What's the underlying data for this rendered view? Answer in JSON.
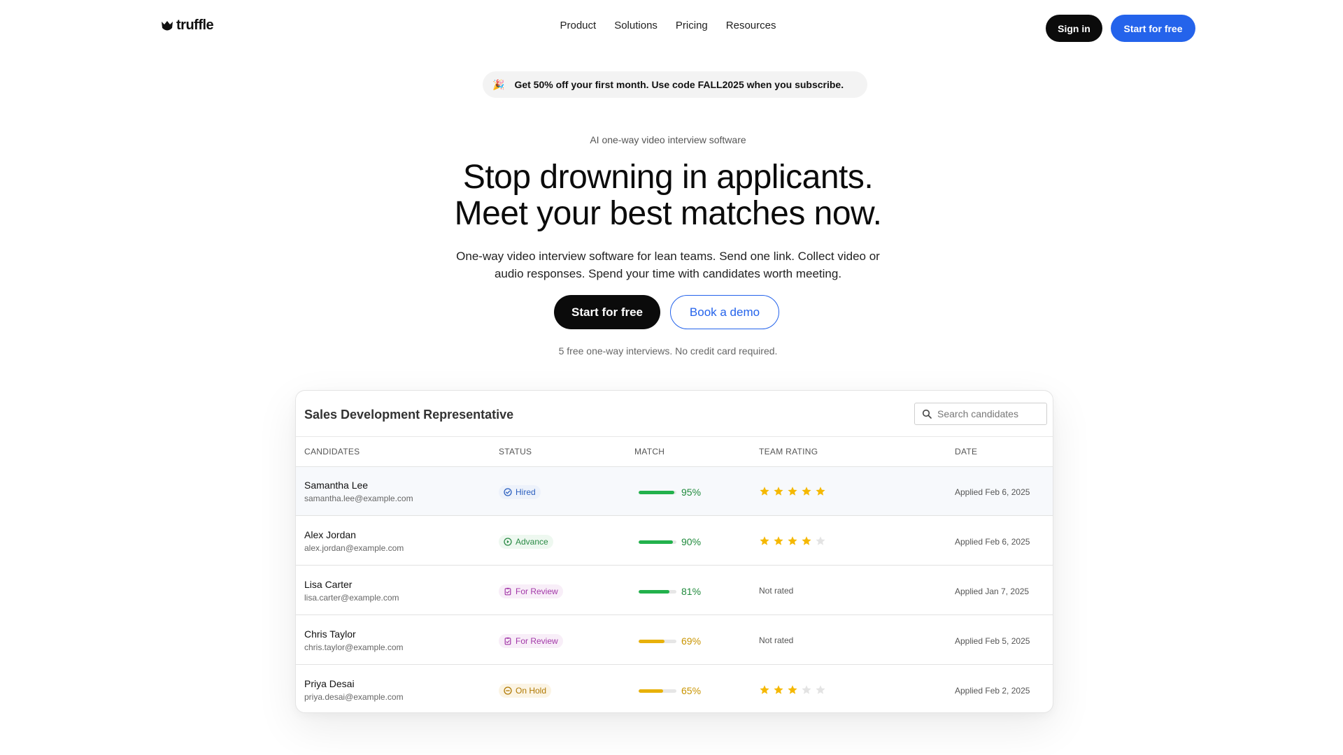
{
  "brand": {
    "name": "truffle",
    "icon": "truffle-logo-icon"
  },
  "nav": {
    "links": [
      "Product",
      "Solutions",
      "Pricing",
      "Resources"
    ],
    "signin_label": "Sign in",
    "start_label": "Start for free"
  },
  "promo": {
    "icon": "party-popper-icon",
    "text": "Get 50% off your first month. Use code FALL2025 when you subscribe."
  },
  "hero": {
    "eyebrow": "AI one-way video interview software",
    "headline_line1": "Stop drowning in applicants.",
    "headline_line2": "Meet your best matches now.",
    "sub_line1": "One-way video interview software for lean teams. Send one link. Collect video or",
    "sub_line2": "audio responses. Spend your time with candidates worth meeting.",
    "start_label": "Start for free",
    "demo_label": "Book a demo",
    "note": "5 free one-way interviews.  No credit card required."
  },
  "table": {
    "title": "Sales Development Representative",
    "search_placeholder": "Search candidates",
    "columns": [
      "CANDIDATES",
      "STATUS",
      "MATCH",
      "TEAM RATING",
      "DATE"
    ],
    "rows": [
      {
        "name": "Samantha Lee",
        "email": "samantha.lee@example.com",
        "status": "Hired",
        "status_kind": "hired",
        "match": 95,
        "match_label": "95%",
        "color": "green",
        "rating": 5,
        "rating_text": "",
        "date": "Applied Feb 6, 2025"
      },
      {
        "name": "Alex Jordan",
        "email": "alex.jordan@example.com",
        "status": "Advance",
        "status_kind": "advance",
        "match": 90,
        "match_label": "90%",
        "color": "green",
        "rating": 4,
        "rating_text": "",
        "date": "Applied Feb 6, 2025"
      },
      {
        "name": "Lisa Carter",
        "email": "lisa.carter@example.com",
        "status": "For Review",
        "status_kind": "review",
        "match": 81,
        "match_label": "81%",
        "color": "green",
        "rating": 0,
        "rating_text": "Not rated",
        "date": "Applied Jan 7, 2025"
      },
      {
        "name": "Chris Taylor",
        "email": "chris.taylor@example.com",
        "status": "For Review",
        "status_kind": "review",
        "match": 69,
        "match_label": "69%",
        "color": "yellow",
        "rating": 0,
        "rating_text": "Not rated",
        "date": "Applied Feb 5, 2025"
      },
      {
        "name": "Priya Desai",
        "email": "priya.desai@example.com",
        "status": "On Hold",
        "status_kind": "hold",
        "match": 65,
        "match_label": "65%",
        "color": "yellow",
        "rating": 3,
        "rating_text": "",
        "date": "Applied Feb 2, 2025"
      }
    ]
  },
  "colors": {
    "accent": "#2463eb",
    "dark": "#0b0b0b",
    "star": "#f5b800",
    "star_empty": "#e3e3e3"
  }
}
